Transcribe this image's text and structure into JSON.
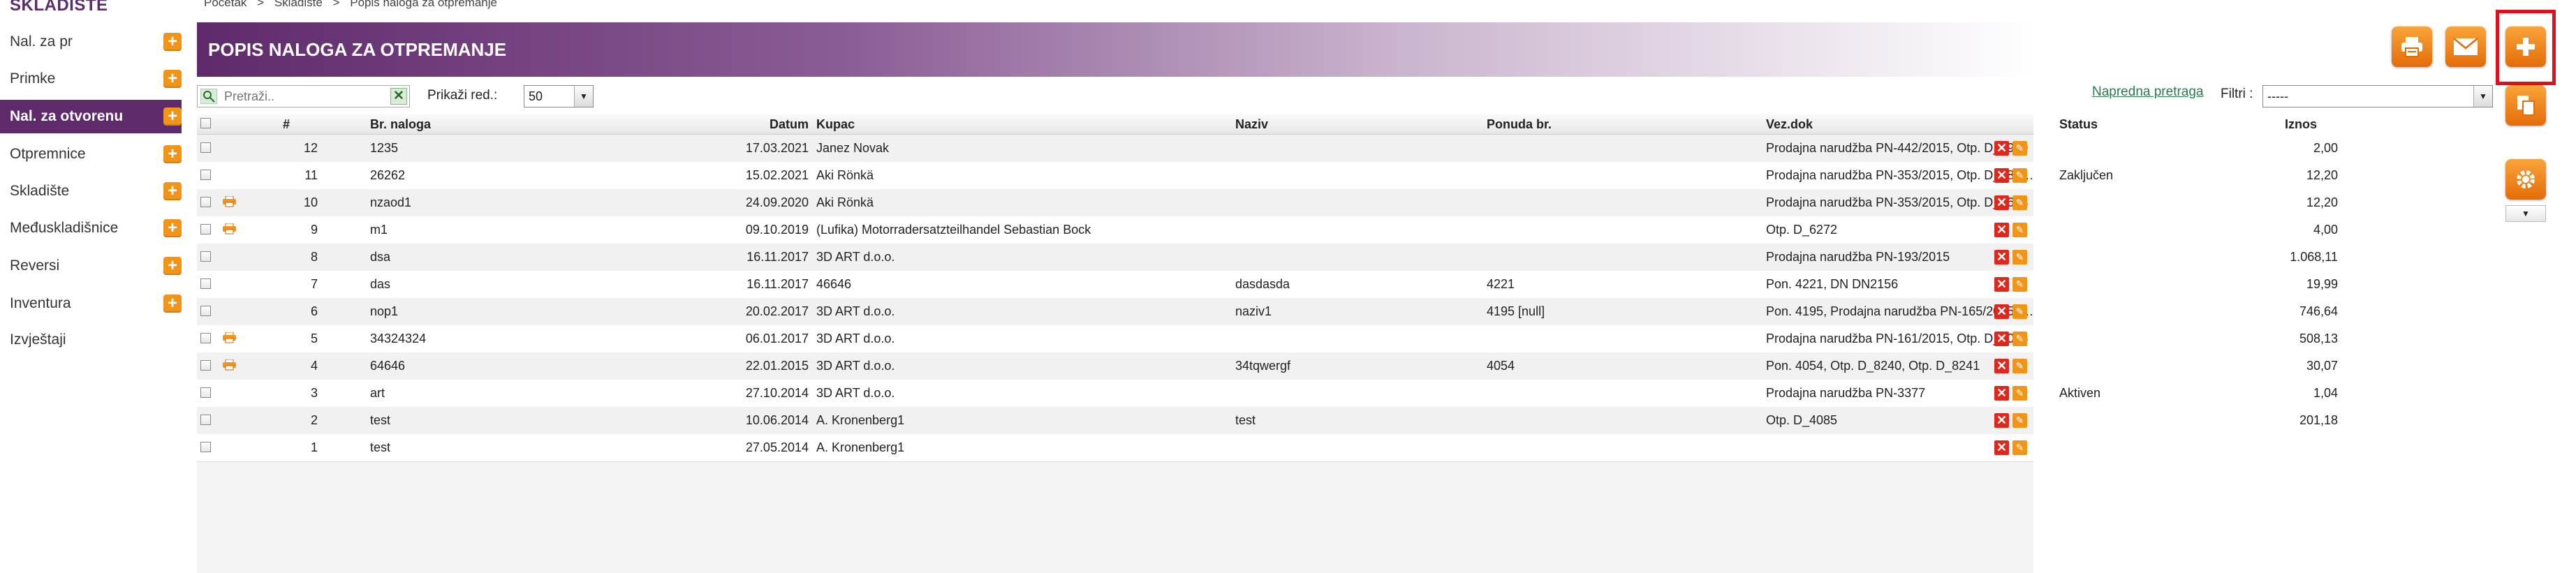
{
  "breadcrumb": [
    "Početak",
    "Skladište",
    "Popis naloga za otpremanje"
  ],
  "breadcrumb_sep": ">",
  "sidebar": {
    "title": "SKLADIŠTE",
    "items": [
      {
        "label": "Nal. za pr",
        "plus": "+"
      },
      {
        "label": "Primke",
        "plus": "+"
      },
      {
        "label": "Nal. za otvorenu",
        "plus": "+"
      },
      {
        "label": "Otpremnice",
        "plus": "+"
      },
      {
        "label": "Skladište",
        "plus": "+"
      },
      {
        "label": "Međuskladišnice",
        "plus": "+"
      },
      {
        "label": "Reversi",
        "plus": "+"
      },
      {
        "label": "Inventura",
        "plus": "+"
      },
      {
        "label": "Izvještaji"
      }
    ]
  },
  "header": {
    "title": "POPIS NALOGA ZA OTPREMANJE"
  },
  "toolbar": {
    "print_icon": "printer-icon",
    "mail_icon": "envelope-icon",
    "add_icon": "plus-icon",
    "copy_icon": "copy-icon",
    "settings_icon": "gear-icon",
    "accent": "#f29418"
  },
  "filters": {
    "search_placeholder": "Pretraži..",
    "show_rows_label": "Prikaži red.:",
    "show_rows_value": "50",
    "advanced_search": "Napredna pretraga",
    "filter_label": "Filtri :",
    "filter_value": "-----"
  },
  "table": {
    "columns": [
      "#",
      "Br. naloga",
      "Datum",
      "Kupac",
      "Naziv",
      "Ponuda br.",
      "Vez.dok",
      "Status",
      "Iznos"
    ],
    "rows": [
      {
        "num": "12",
        "br": "1235",
        "datum": "17.03.2021",
        "kupac": "Janez Novak",
        "naziv": "",
        "ponuda": "",
        "vezdok": "Prodajna narudžba PN-442/2015, Otp. D_6939",
        "status": "",
        "iznos": "2,00",
        "print": false
      },
      {
        "num": "11",
        "br": "26262",
        "datum": "15.02.2021",
        "kupac": "Aki Rönkä",
        "naziv": "",
        "ponuda": "",
        "vezdok": "Prodajna narudžba PN-353/2015, Otp. D_687…",
        "status": "Zaključen",
        "iznos": "12,20",
        "print": false
      },
      {
        "num": "10",
        "br": "nzaod1",
        "datum": "24.09.2020",
        "kupac": "Aki Rönkä",
        "naziv": "",
        "ponuda": "",
        "vezdok": "Prodajna narudžba PN-353/2015, Otp. D_6628",
        "status": "",
        "iznos": "12,20",
        "print": true
      },
      {
        "num": "9",
        "br": "m1",
        "datum": "09.10.2019",
        "kupac": "(Lufika) Motorradersatzteilhandel Sebastian Bock",
        "naziv": "",
        "ponuda": "",
        "vezdok": "Otp. D_6272",
        "status": "",
        "iznos": "4,00",
        "print": true
      },
      {
        "num": "8",
        "br": "dsa",
        "datum": "16.11.2017",
        "kupac": "3D ART d.o.o.",
        "naziv": "",
        "ponuda": "",
        "vezdok": "Prodajna narudžba PN-193/2015",
        "status": "",
        "iznos": "1.068,11",
        "print": false
      },
      {
        "num": "7",
        "br": "das",
        "datum": "16.11.2017",
        "kupac": "46646",
        "naziv": "dasdasda",
        "ponuda": "4221",
        "vezdok": "Pon. 4221, DN DN2156",
        "status": "",
        "iznos": "19,99",
        "print": false
      },
      {
        "num": "6",
        "br": "nop1",
        "datum": "20.02.2017",
        "kupac": "3D ART d.o.o.",
        "naziv": "naziv1",
        "ponuda": "4195 [null]",
        "vezdok": "Pon. 4195, Prodajna narudžba PN-165/2015, …",
        "status": "",
        "iznos": "746,64",
        "print": false
      },
      {
        "num": "5",
        "br": "34324324",
        "datum": "06.01.2017",
        "kupac": "3D ART d.o.o.",
        "naziv": "",
        "ponuda": "",
        "vezdok": "Prodajna narudžba PN-161/2015, Otp. D_5026",
        "status": "",
        "iznos": "508,13",
        "print": true
      },
      {
        "num": "4",
        "br": "64646",
        "datum": "22.01.2015",
        "kupac": "3D ART d.o.o.",
        "naziv": "34tqwergf",
        "ponuda": "4054",
        "vezdok": "Pon. 4054, Otp. D_8240, Otp. D_8241",
        "status": "",
        "iznos": "30,07",
        "print": true
      },
      {
        "num": "3",
        "br": "art",
        "datum": "27.10.2014",
        "kupac": "3D ART d.o.o.",
        "naziv": "",
        "ponuda": "",
        "vezdok": "Prodajna narudžba PN-3377",
        "status": "Aktiven",
        "iznos": "1,04",
        "print": false
      },
      {
        "num": "2",
        "br": "test",
        "datum": "10.06.2014",
        "kupac": "A. Kronenberg1",
        "naziv": "test",
        "ponuda": "",
        "vezdok": "Otp. D_4085",
        "status": "",
        "iznos": "201,18",
        "print": false
      },
      {
        "num": "1",
        "br": "test",
        "datum": "27.05.2014",
        "kupac": "A. Kronenberg1",
        "naziv": "",
        "ponuda": "",
        "vezdok": "",
        "status": "",
        "iznos": "",
        "print": false
      }
    ]
  }
}
